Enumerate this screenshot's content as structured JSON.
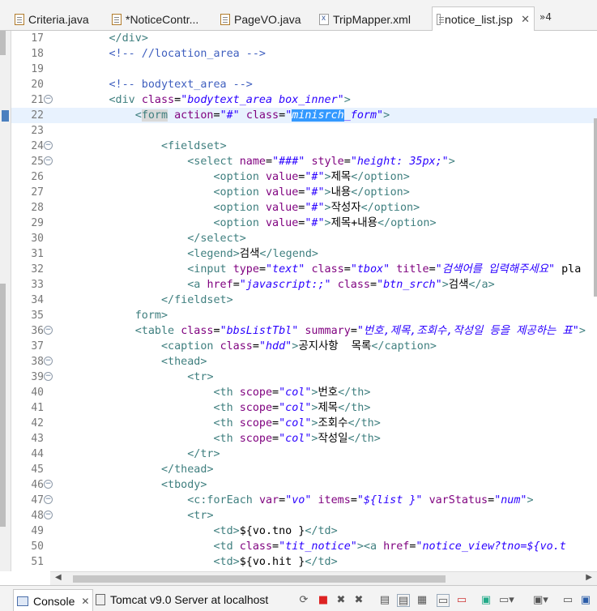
{
  "tabs": [
    {
      "label": "Criteria.java",
      "icon": "java-file-icon"
    },
    {
      "label": "*NoticeContr...",
      "icon": "java-file-icon"
    },
    {
      "label": "PageVO.java",
      "icon": "java-file-icon"
    },
    {
      "label": "TripMapper.xml",
      "icon": "xml-file-icon"
    },
    {
      "label": "notice_list.jsp",
      "icon": "jsp-file-icon",
      "active": true,
      "close": "✕"
    }
  ],
  "overflow_tabs": "»4",
  "line_numbers": [
    "17",
    "18",
    "19",
    "20",
    "21",
    "22",
    "23",
    "24",
    "25",
    "26",
    "27",
    "28",
    "29",
    "30",
    "31",
    "32",
    "33",
    "34",
    "35",
    "36",
    "37",
    "38",
    "39",
    "40",
    "41",
    "42",
    "43",
    "44",
    "45",
    "46",
    "47",
    "48",
    "49",
    "50",
    "51"
  ],
  "code_lines": [
    "        </div>",
    "        <!-- //location_area -->",
    "",
    "        <!-- bodytext_area -->",
    "        <div class=\"bodytext_area box_inner\">",
    "            <form action=\"#\" class=\"minisrch_form\">",
    "",
    "                <fieldset>",
    "                    <select name=\"###\" style=\"height: 35px;\">",
    "                        <option value=\"#\">제목</option>",
    "                        <option value=\"#\">내용</option>",
    "                        <option value=\"#\">작성자</option>",
    "                        <option value=\"#\">제목+내용</option>",
    "                    </select>",
    "                    <legend>검색</legend>",
    "                    <input type=\"text\" class=\"tbox\" title=\"검색어를 입력해주세요\" pla",
    "                    <a href=\"javascript:;\" class=\"btn_srch\">검색</a>",
    "                </fieldset>",
    "            </form>",
    "            <table class=\"bbsListTbl\" summary=\"번호,제목,조회수,작성일 등을 제공하는 표\">",
    "                <caption class=\"hdd\">공지사항  목록</caption>",
    "                <thead>",
    "                    <tr>",
    "                        <th scope=\"col\">번호</th>",
    "                        <th scope=\"col\">제목</th>",
    "                        <th scope=\"col\">조회수</th>",
    "                        <th scope=\"col\">작성일</th>",
    "                    </tr>",
    "                </thead>",
    "                <tbody>",
    "                    <c:forEach var=\"vo\" items=\"${list }\" varStatus=\"num\">",
    "                    <tr>",
    "                        <td>${vo.tno }</td>",
    "                        <td class=\"tit_notice\"><a href=\"notice_view?tno=${vo.t",
    "                        <td>${vo.hit }</td>"
  ],
  "fold_lines": [
    "21",
    "24",
    "25",
    "36",
    "38",
    "39",
    "46",
    "47",
    "48"
  ],
  "bottom": {
    "console_label": "Console",
    "server_label": "Tomcat v9.0 Server at localhost"
  },
  "colors": {
    "tag": "#3f7f7f",
    "attr": "#7f007f",
    "value": "#2a00ff",
    "comment": "#3f5fbf",
    "current_line": "#e8f2fe",
    "selection": "#3399ff"
  }
}
